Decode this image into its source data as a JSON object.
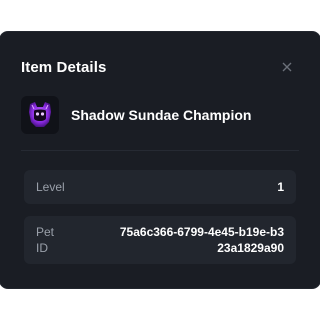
{
  "modal": {
    "title": "Item Details",
    "close_icon": "close-icon"
  },
  "item": {
    "name": "Shadow Sundae Champion",
    "thumbnail_icon": "pet-thumbnail-icon"
  },
  "fields": {
    "level_label": "Level",
    "level_value": "1",
    "pet_id_label": "Pet\nID",
    "pet_id_value": "75a6c366-6799-4e45-b19e-b323a1829a90"
  },
  "colors": {
    "background": "#1a1d24",
    "field_bg": "#22262e",
    "accent": "#9b3df0"
  }
}
